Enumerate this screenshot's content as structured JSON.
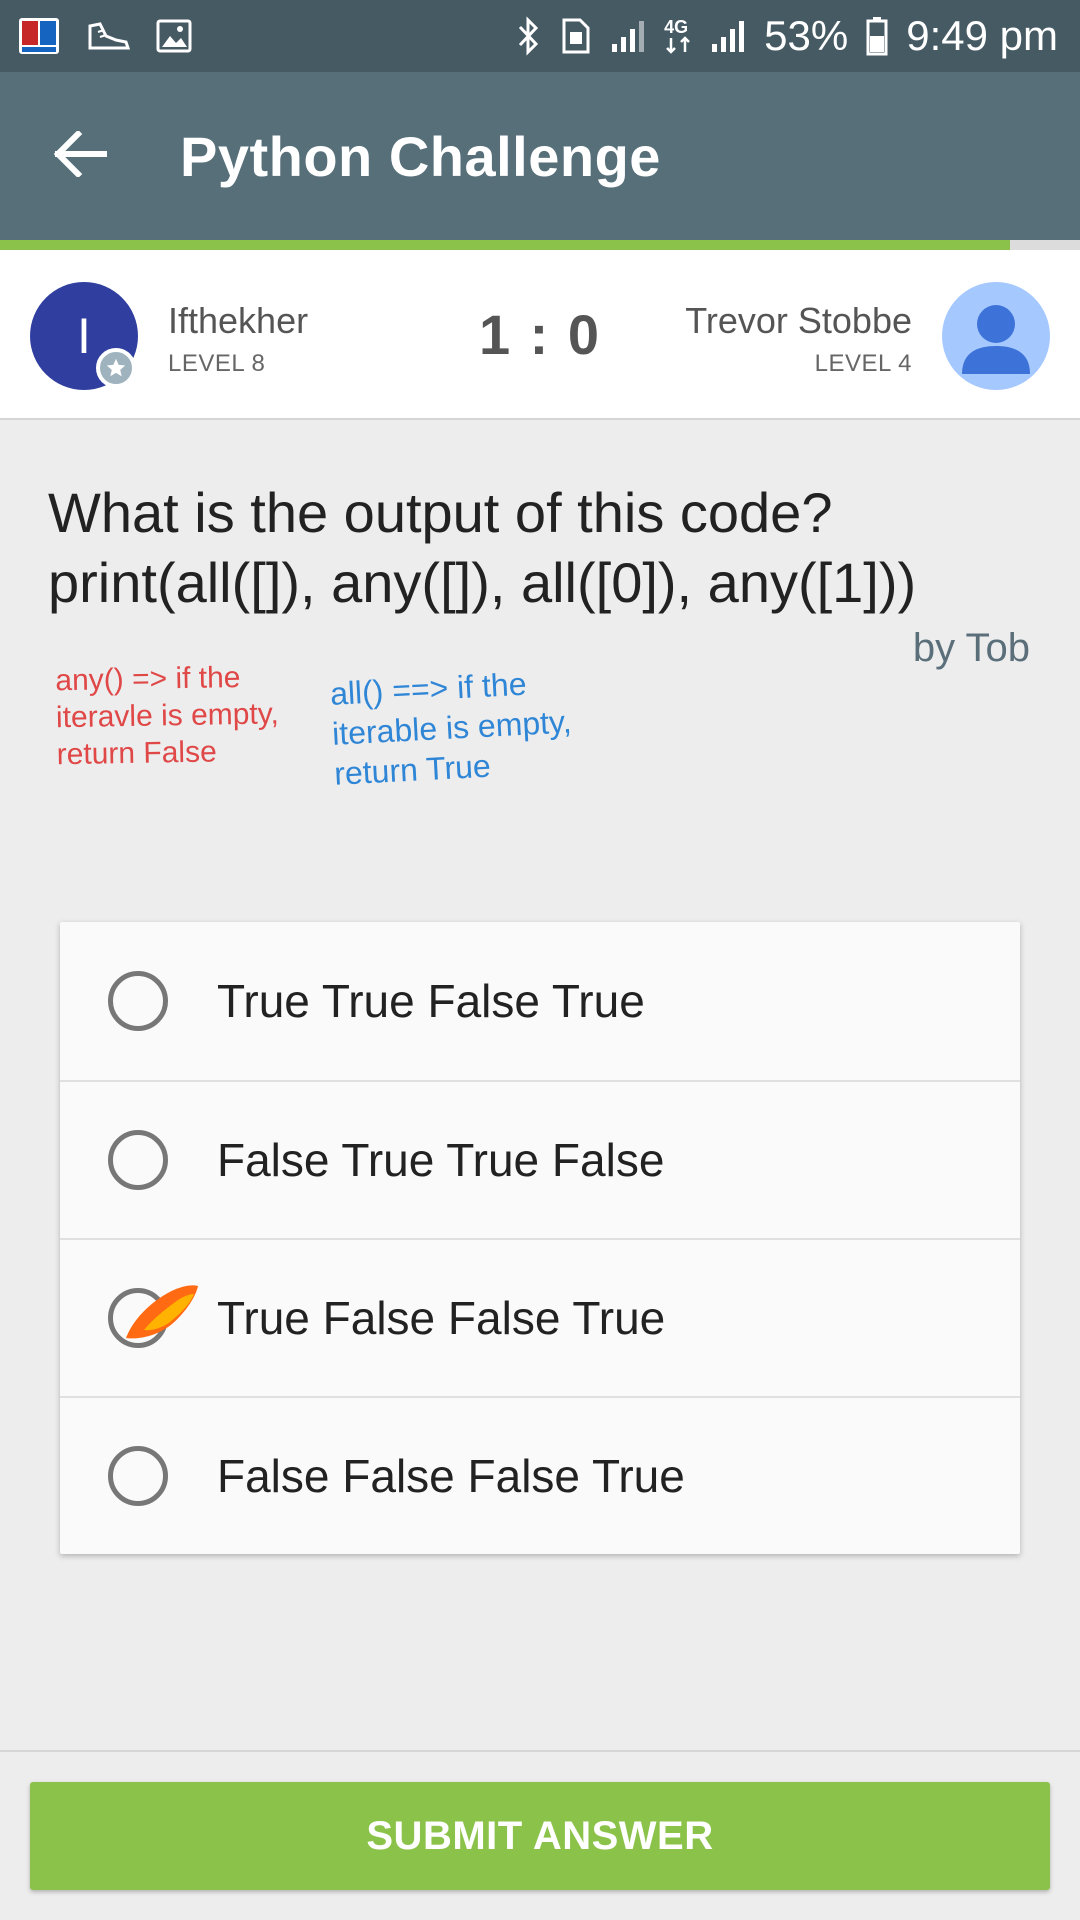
{
  "status_bar": {
    "battery": "53%",
    "time": "9:49 pm",
    "network_label": "4G",
    "icons": [
      "app-book-icon",
      "shoe-icon",
      "image-icon",
      "bluetooth-icon",
      "sim-icon",
      "signal-icon",
      "signal-icon",
      "battery-icon"
    ]
  },
  "app_bar": {
    "title": "Python Challenge",
    "back_icon": "arrow-left-icon"
  },
  "progress": {
    "fraction": 0.935,
    "color": "#8bc34a"
  },
  "players": {
    "left": {
      "initial": "I",
      "name": "Ifthekher",
      "level": "LEVEL 8",
      "avatar_color": "#303f9f"
    },
    "score": "1 : 0",
    "right": {
      "name": "Trevor Stobbe",
      "level": "LEVEL 4",
      "avatar_color": "#a5c8ff"
    }
  },
  "question": {
    "line1": "What is the output of this code?",
    "line2": "print(all([]), any([]), all([0]), any([1]))",
    "author": "by Tob"
  },
  "notes": {
    "red": "any() => if the iteravle is empty, return False",
    "blue": "all() ==> if the iterable is empty, return True"
  },
  "options": [
    {
      "label": "True True False True",
      "selected": false
    },
    {
      "label": "False True True False",
      "selected": false
    },
    {
      "label": "True False False True",
      "selected": false,
      "marked": true
    },
    {
      "label": "False False False True",
      "selected": false
    }
  ],
  "submit": {
    "label": "SUBMIT ANSWER",
    "color": "#8bc34a"
  }
}
